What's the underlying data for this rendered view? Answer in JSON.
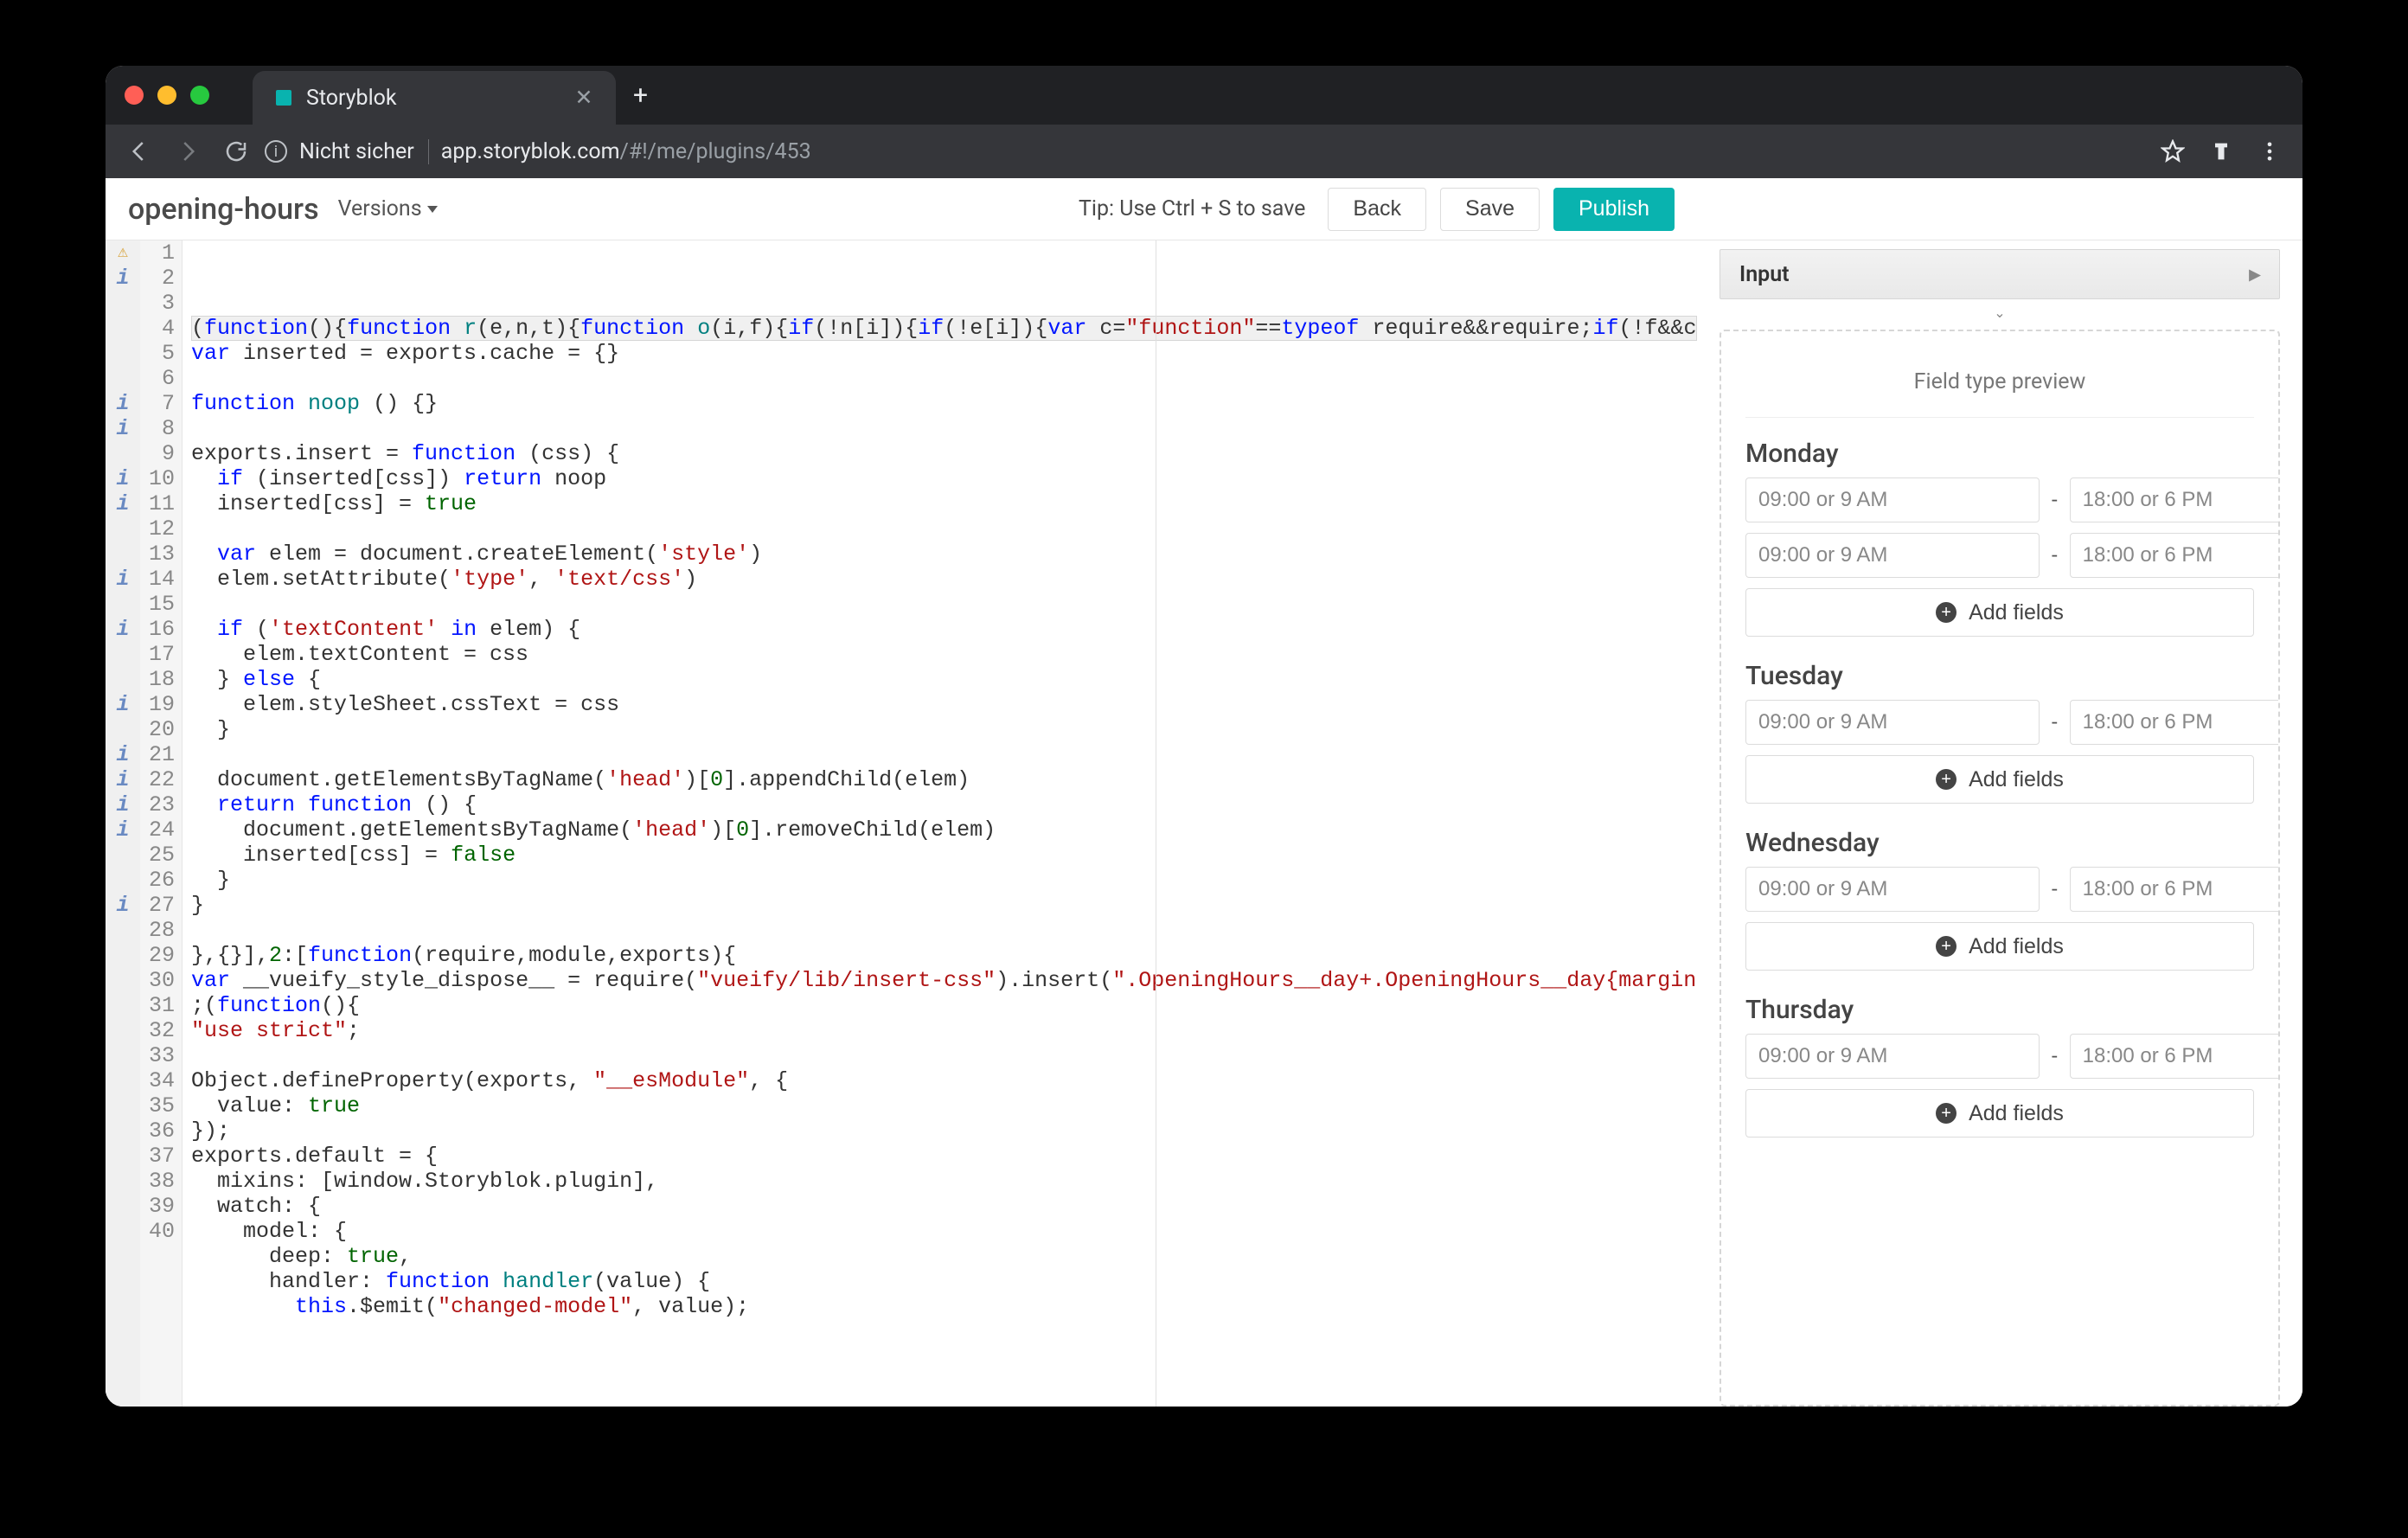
{
  "browser": {
    "tab_title": "Storyblok",
    "not_secure_label": "Nicht sicher",
    "url_host": "app.storyblok.com",
    "url_path": "/#!/me/plugins/453"
  },
  "header": {
    "title": "opening-hours",
    "versions_label": "Versions",
    "tip": "Tip: Use Ctrl + S to save",
    "back": "Back",
    "save": "Save",
    "publish": "Publish"
  },
  "code": {
    "lines": [
      {
        "n": 1,
        "gutter": "warn",
        "cls": "highlight",
        "html": "(<span class='k-blue'>function</span>(){<span class='k-blue'>function</span> <span class='k-teal'>r</span>(e,n,t){<span class='k-blue'>function</span> <span class='k-teal'>o</span>(i,f){<span class='k-blue'>if</span>(!n[i]){<span class='k-blue'>if</span>(!e[i]){<span class='k-blue'>var</span> c=<span class='k-str'>\"function\"</span>==<span class='k-blue'>typeof</span> require&amp;&amp;require;<span class='k-blue'>if</span>(!f&amp;&amp;c)"
      },
      {
        "n": 2,
        "gutter": "info",
        "html": "<span class='k-blue'>var</span> inserted = exports.cache = {}"
      },
      {
        "n": 3,
        "gutter": "",
        "html": ""
      },
      {
        "n": 4,
        "gutter": "",
        "html": "<span class='k-blue'>function</span> <span class='k-teal'>noop</span> () {}"
      },
      {
        "n": 5,
        "gutter": "",
        "html": ""
      },
      {
        "n": 6,
        "gutter": "",
        "html": "exports.insert = <span class='k-blue'>function</span> (css) {"
      },
      {
        "n": 7,
        "gutter": "info",
        "html": "  <span class='k-blue'>if</span> (inserted[css]) <span class='k-blue'>return</span> noop"
      },
      {
        "n": 8,
        "gutter": "info",
        "html": "  inserted[css] = <span class='k-green'>true</span>"
      },
      {
        "n": 9,
        "gutter": "",
        "html": ""
      },
      {
        "n": 10,
        "gutter": "info",
        "html": "  <span class='k-blue'>var</span> elem = document.createElement(<span class='k-str'>'style'</span>)"
      },
      {
        "n": 11,
        "gutter": "info",
        "html": "  elem.setAttribute(<span class='k-str'>'type'</span>, <span class='k-str'>'text/css'</span>)"
      },
      {
        "n": 12,
        "gutter": "",
        "html": ""
      },
      {
        "n": 13,
        "gutter": "",
        "html": "  <span class='k-blue'>if</span> (<span class='k-str'>'textContent'</span> <span class='k-blue'>in</span> elem) {"
      },
      {
        "n": 14,
        "gutter": "info",
        "html": "    elem.textContent = css"
      },
      {
        "n": 15,
        "gutter": "",
        "html": "  } <span class='k-blue'>else</span> {"
      },
      {
        "n": 16,
        "gutter": "info",
        "html": "    elem.styleSheet.cssText = css"
      },
      {
        "n": 17,
        "gutter": "",
        "html": "  }"
      },
      {
        "n": 18,
        "gutter": "",
        "html": ""
      },
      {
        "n": 19,
        "gutter": "info",
        "html": "  document.getElementsByTagName(<span class='k-str'>'head'</span>)[<span class='k-num'>0</span>].appendChild(elem)"
      },
      {
        "n": 20,
        "gutter": "",
        "html": "  <span class='k-blue'>return function</span> () {"
      },
      {
        "n": 21,
        "gutter": "info",
        "html": "    document.getElementsByTagName(<span class='k-str'>'head'</span>)[<span class='k-num'>0</span>].removeChild(elem)"
      },
      {
        "n": 22,
        "gutter": "info",
        "html": "    inserted[css] = <span class='k-green'>false</span>"
      },
      {
        "n": 23,
        "gutter": "info",
        "html": "  }"
      },
      {
        "n": 24,
        "gutter": "info",
        "html": "}"
      },
      {
        "n": 25,
        "gutter": "",
        "html": ""
      },
      {
        "n": 26,
        "gutter": "",
        "html": "},{}],<span class='k-num'>2</span>:[<span class='k-blue'>function</span>(require,module,exports){"
      },
      {
        "n": 27,
        "gutter": "info",
        "html": "<span class='k-blue'>var</span> __vueify_style_dispose__ = require(<span class='k-str'>\"vueify/lib/insert-css\"</span>).insert(<span class='k-str'>\".OpeningHours__day+.OpeningHours__day{margin-</span>"
      },
      {
        "n": 28,
        "gutter": "",
        "html": ";(<span class='k-blue'>function</span>(){"
      },
      {
        "n": 29,
        "gutter": "",
        "html": "<span class='k-str'>\"use strict\"</span>;"
      },
      {
        "n": 30,
        "gutter": "",
        "html": ""
      },
      {
        "n": 31,
        "gutter": "",
        "html": "Object.defineProperty(exports, <span class='k-str'>\"__esModule\"</span>, {"
      },
      {
        "n": 32,
        "gutter": "",
        "html": "  value: <span class='k-green'>true</span>"
      },
      {
        "n": 33,
        "gutter": "",
        "html": "});"
      },
      {
        "n": 34,
        "gutter": "",
        "html": "exports.default = {"
      },
      {
        "n": 35,
        "gutter": "",
        "html": "  mixins: [window.Storyblok.plugin],"
      },
      {
        "n": 36,
        "gutter": "",
        "html": "  watch: {"
      },
      {
        "n": 37,
        "gutter": "",
        "html": "    model: {"
      },
      {
        "n": 38,
        "gutter": "",
        "html": "      deep: <span class='k-green'>true</span>,"
      },
      {
        "n": 39,
        "gutter": "",
        "html": "      handler: <span class='k-blue'>function</span> <span class='k-teal'>handler</span>(value) {"
      },
      {
        "n": 40,
        "gutter": "",
        "html": "        <span class='k-blue'>this</span>.$emit(<span class='k-str'>\"changed-model\"</span>, value);"
      }
    ]
  },
  "right": {
    "input_label": "Input",
    "preview_label": "Field type preview",
    "add_label": "Add fields",
    "open_placeholder": "09:00 or 9 AM",
    "close_placeholder": "18:00 or 6 PM",
    "days": [
      {
        "name": "Monday",
        "rows": 2
      },
      {
        "name": "Tuesday",
        "rows": 1
      },
      {
        "name": "Wednesday",
        "rows": 1
      },
      {
        "name": "Thursday",
        "rows": 1
      }
    ]
  }
}
